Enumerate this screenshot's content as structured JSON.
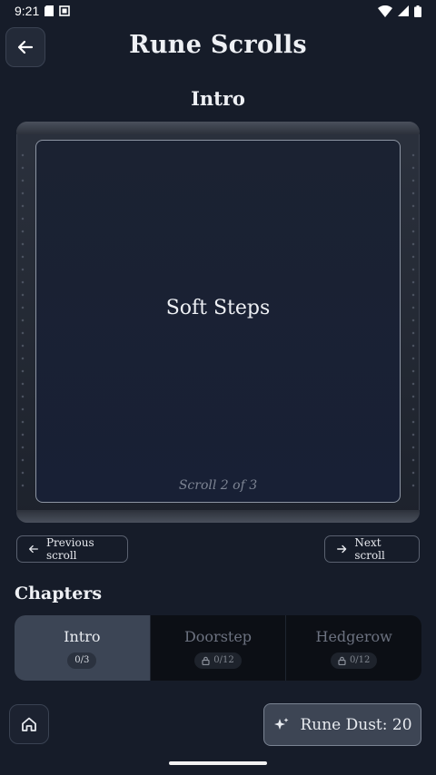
{
  "status_bar": {
    "time": "9:21"
  },
  "header": {
    "title": "Rune Scrolls"
  },
  "section": {
    "title": "Intro"
  },
  "scroll": {
    "heading": "Soft Steps",
    "counter": "Scroll 2 of 3"
  },
  "navigation": {
    "previous_label": "Previous scroll",
    "next_label": "Next scroll"
  },
  "chapters": {
    "label": "Chapters",
    "items": [
      {
        "name": "Intro",
        "progress": "0/3",
        "locked": false,
        "active": true
      },
      {
        "name": "Doorstep",
        "progress": "0/12",
        "locked": true,
        "active": false
      },
      {
        "name": "Hedgerow",
        "progress": "0/12",
        "locked": true,
        "active": false
      }
    ]
  },
  "footer": {
    "dust_label": "Rune Dust: 20"
  },
  "icons": {
    "back": "arrow-left-icon",
    "prev": "arrow-left-icon",
    "next": "arrow-right-icon",
    "lock": "lock-icon",
    "home": "home-icon",
    "sparkle": "sparkle-icon"
  },
  "colors": {
    "background": "#161c29",
    "active_tab": "#3c4555",
    "accent_text": "#eef0f4"
  }
}
